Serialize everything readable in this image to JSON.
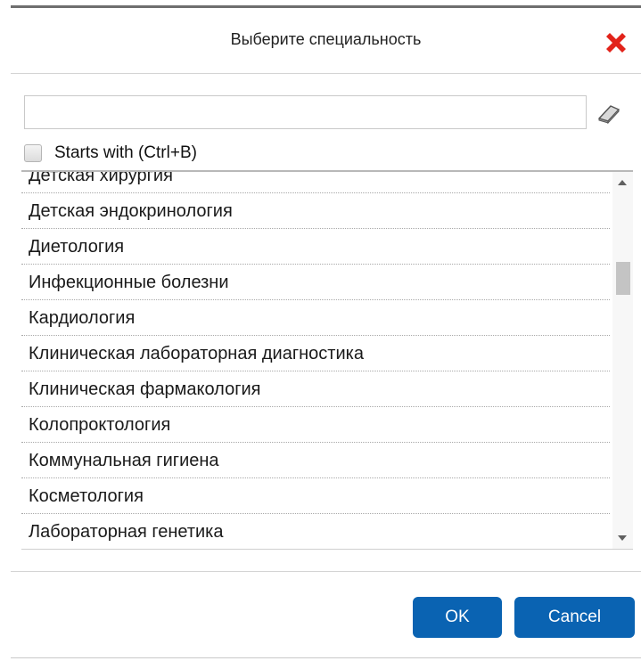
{
  "dialog": {
    "title": "Выберите специальность"
  },
  "search": {
    "value": "",
    "placeholder": ""
  },
  "starts_with": {
    "label": "Starts with (Ctrl+B)",
    "checked": false
  },
  "list": {
    "items": [
      "Детская хирургия",
      "Детская эндокринология",
      "Диетология",
      "Инфекционные болезни",
      "Кардиология",
      "Клиническая лабораторная диагностика",
      "Клиническая фармакология",
      "Колопроктология",
      "Коммунальная гигиена",
      "Косметология",
      "Лабораторная генетика"
    ]
  },
  "buttons": {
    "ok_label": "OK",
    "cancel_label": "Cancel"
  },
  "colors": {
    "primary_button": "#0a63b2",
    "close_icon": "#e2231a"
  },
  "icons": {
    "close": "close-icon",
    "clear": "eraser-icon",
    "scroll_up": "scroll-up-arrow-icon",
    "scroll_down": "scroll-down-arrow-icon"
  }
}
